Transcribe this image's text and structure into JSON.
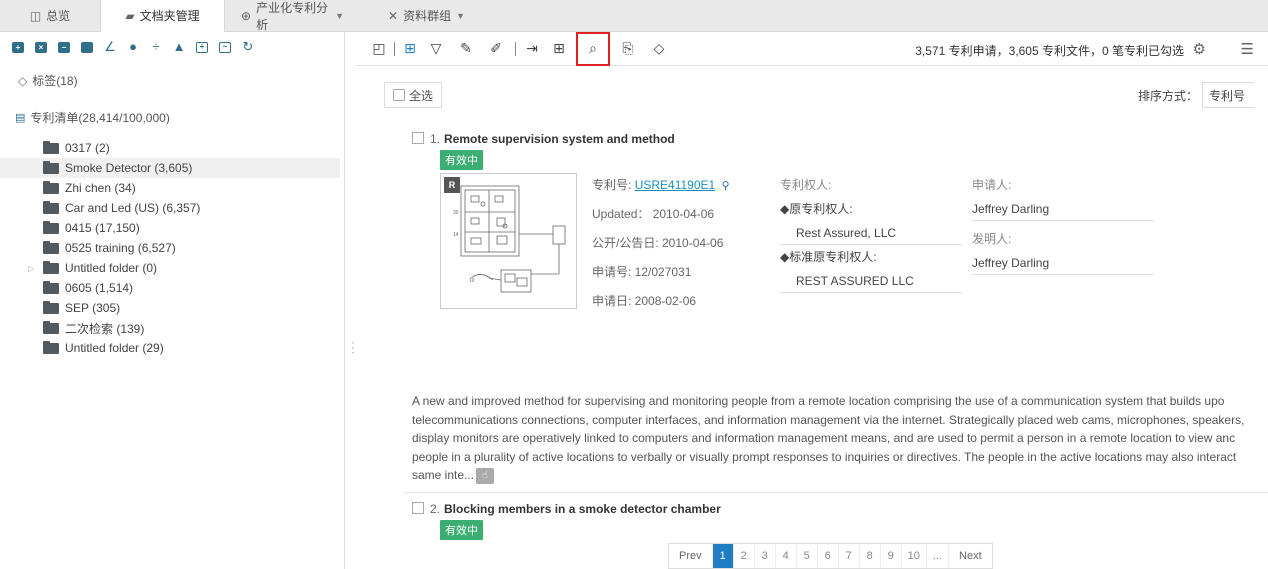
{
  "tabs": [
    {
      "label": "总览",
      "icon": "dashboard-icon"
    },
    {
      "label": "文档夹管理",
      "icon": "folder-open-icon"
    },
    {
      "label": "产业化专利分析",
      "icon": "analysis-icon"
    },
    {
      "label": "资料群组",
      "icon": "group-icon"
    }
  ],
  "sidebar": {
    "tags_label": "标签(18)",
    "list_label": "专利清单(28,414/100,000)",
    "folders": [
      {
        "label": "0317  (2)"
      },
      {
        "label": "Smoke Detector  (3,605)",
        "selected": true
      },
      {
        "label": "Zhi chen   (34)"
      },
      {
        "label": "Car and Led (US)  (6,357)"
      },
      {
        "label": "0415  (17,150)"
      },
      {
        "label": "0525 training  (6,527)"
      },
      {
        "label": "Untitled folder  (0)",
        "expandable": true
      },
      {
        "label": "0605  (1,514)"
      },
      {
        "label": "SEP  (305)"
      },
      {
        "label": "二次检索  (139)"
      },
      {
        "label": "Untitled folder  (29)"
      }
    ]
  },
  "toolbar": {
    "stats": "3,571 专利申请，3,605 专利文件，0 笔专利已勾选"
  },
  "controls": {
    "select_all": "全选",
    "sort_label": "排序方式：",
    "sort_value": "专利号"
  },
  "results": [
    {
      "num": "1.",
      "title": "Remote supervision system and method",
      "status": "有效中",
      "thumb_tag": "R",
      "patent_no_label": "专利号:",
      "patent_no": "USRE41190E1",
      "updated": "Updated：  2010-04-06",
      "pub_date": "公开/公告日: 2010-04-06",
      "app_no": "申请号: 12/027031",
      "app_date": "申请日: 2008-02-06",
      "assignee_label": "专利权人:",
      "orig_assignee_label": "◆原专利权人:",
      "orig_assignee": "Rest Assured, LLC",
      "std_assignee_label": "◆标准原专利权人:",
      "std_assignee": "REST ASSURED LLC",
      "applicant_label": "申请人:",
      "applicant": "Jeffrey Darling",
      "inventor_label": "发明人:",
      "inventor": "Jeffrey Darling",
      "abstract": [
        "A new and improved method for supervising and monitoring people from a remote location comprising the use of a communication system that builds upo",
        "telecommunications connections, computer interfaces, and information management via the internet. Strategically placed web cams, microphones, speakers,",
        "display monitors are operatively linked to computers and information management means, and are used to permit a person in a remote location to view anc",
        "people in a plurality of active locations to verbally or visually prompt responses to inquiries or directives. The people in the active locations may also interact",
        "same inte..."
      ]
    },
    {
      "num": "2.",
      "title": "Blocking members in a smoke detector chamber",
      "status": "有效中"
    }
  ],
  "pager": {
    "prev": "Prev",
    "pages": [
      "1",
      "2",
      "3",
      "4",
      "5",
      "6",
      "7",
      "8",
      "9",
      "10",
      "..."
    ],
    "next": "Next",
    "current": "1"
  }
}
